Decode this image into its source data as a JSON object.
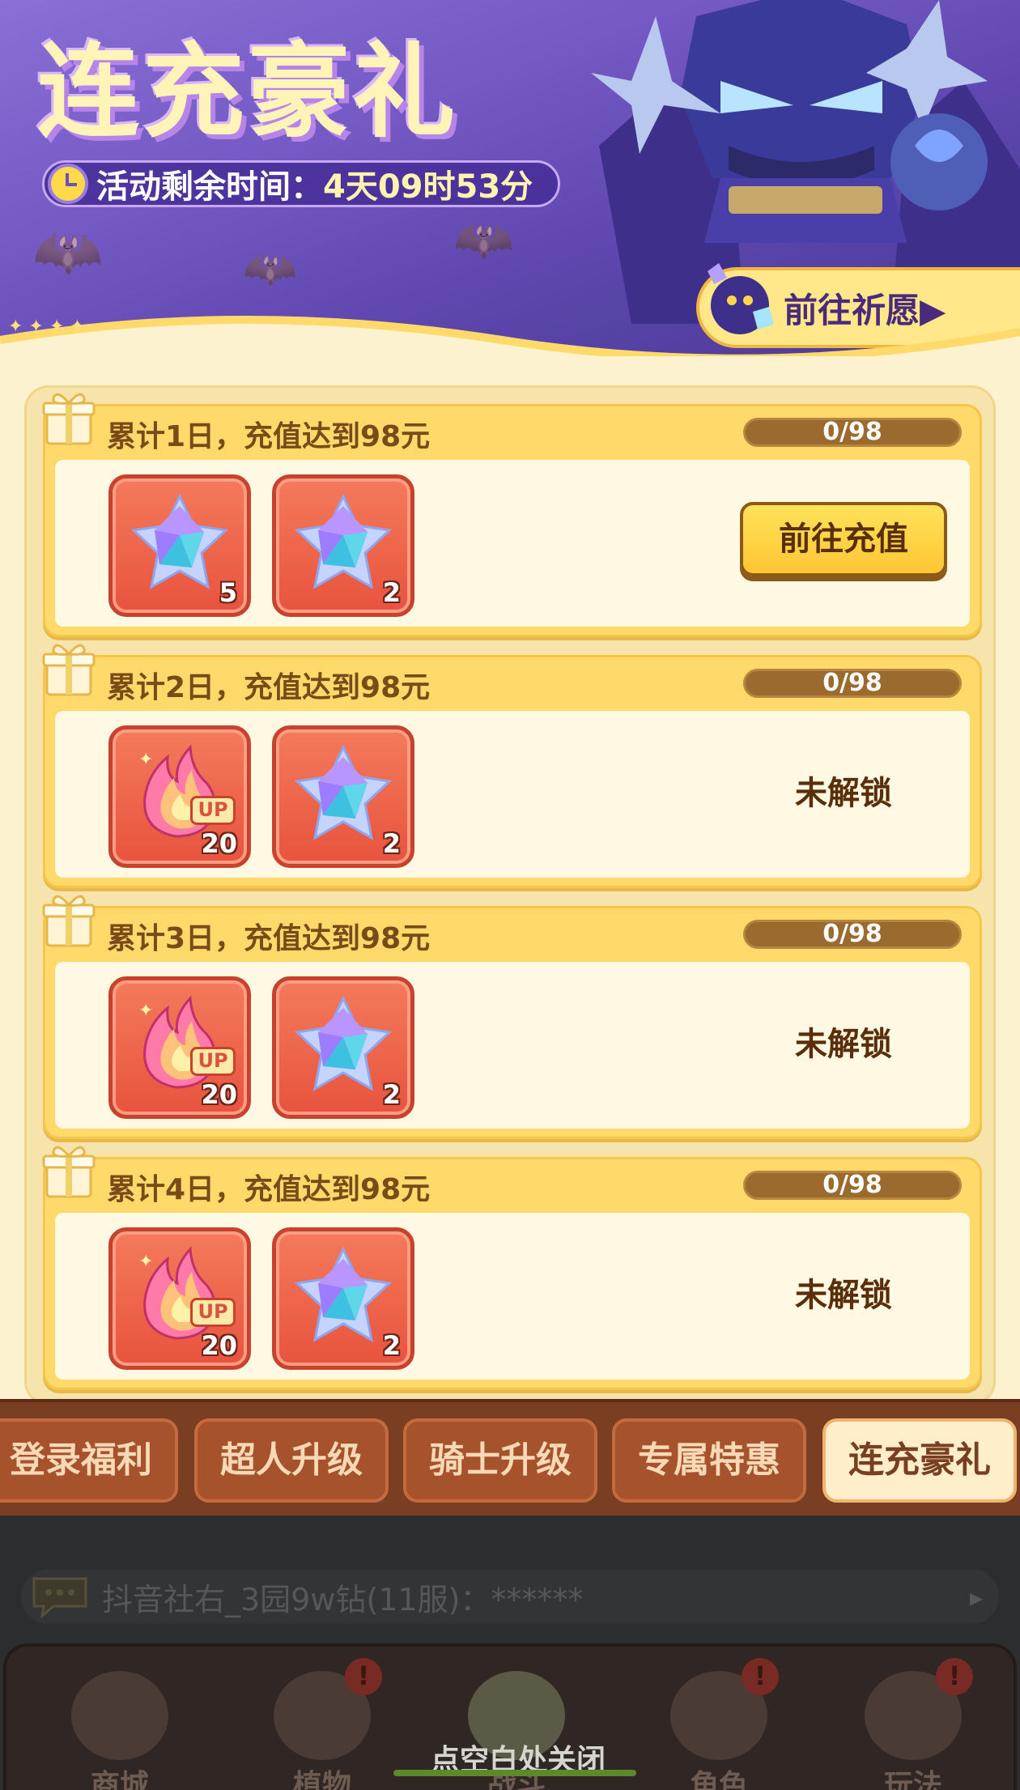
{
  "banner": {
    "title": "连充豪礼",
    "timer_label": "活动剩余时间：",
    "timer_value": "4天09时53分",
    "wish_button": "前往祈愿▶"
  },
  "tiers": [
    {
      "title": "累计1日，充值达到98元",
      "progress": "0/98",
      "rewards": [
        {
          "icon": "purple-star-crystal-icon",
          "qty": "5"
        },
        {
          "icon": "purple-star-crystal-icon",
          "qty": "2"
        }
      ],
      "status": "button",
      "action_label": "前往充值"
    },
    {
      "title": "累计2日，充值达到98元",
      "progress": "0/98",
      "rewards": [
        {
          "icon": "flame-up-icon",
          "qty": "20",
          "badge": "UP"
        },
        {
          "icon": "purple-star-crystal-icon",
          "qty": "2"
        }
      ],
      "status": "locked",
      "action_label": "未解锁"
    },
    {
      "title": "累计3日，充值达到98元",
      "progress": "0/98",
      "rewards": [
        {
          "icon": "flame-up-icon",
          "qty": "20",
          "badge": "UP"
        },
        {
          "icon": "purple-star-crystal-icon",
          "qty": "2"
        }
      ],
      "status": "locked",
      "action_label": "未解锁"
    },
    {
      "title": "累计4日，充值达到98元",
      "progress": "0/98",
      "rewards": [
        {
          "icon": "flame-up-icon",
          "qty": "20",
          "badge": "UP"
        },
        {
          "icon": "purple-star-crystal-icon",
          "qty": "2"
        }
      ],
      "status": "locked",
      "action_label": "未解锁"
    }
  ],
  "tabs": [
    {
      "label": "登录福利",
      "active": false
    },
    {
      "label": "超人升级",
      "active": false
    },
    {
      "label": "骑士升级",
      "active": false
    },
    {
      "label": "专属特惠",
      "active": false
    },
    {
      "label": "连充豪礼",
      "active": true
    }
  ],
  "chat": {
    "text": "抖音社右_3园9w钻(11服)：******",
    "arrow": "▸"
  },
  "nav": [
    {
      "label": "商城",
      "icon": "shop-icon",
      "badge": ""
    },
    {
      "label": "植物",
      "icon": "plant-icon",
      "badge": "!"
    },
    {
      "label": "战斗",
      "icon": "windmill-icon",
      "badge": ""
    },
    {
      "label": "角色",
      "icon": "character-icon",
      "badge": "!"
    },
    {
      "label": "玩法",
      "icon": "gameplay-icon",
      "badge": "!"
    }
  ],
  "close_hint": "点空白处关闭",
  "colors": {
    "accent_yellow": "#ffd96a",
    "tab_active": "#ffeeca",
    "tab_inactive": "#a6532d",
    "banner_purple": "#7559c4"
  }
}
